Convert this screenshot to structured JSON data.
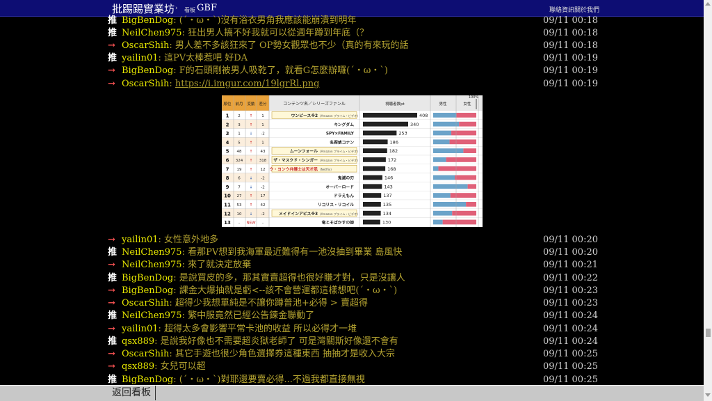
{
  "header": {
    "board_title": "批踢踢實業坊",
    "sep": "›",
    "crumb_label": "看板",
    "board_name": "GBF",
    "links": [
      "聯絡資訊",
      "關於我們"
    ]
  },
  "pushes": [
    {
      "tag": "推",
      "user": "BigBenDog",
      "content": ": (´・ω・`)沒有浴衣男角我應該能崩潰到明年",
      "time": "09/11 00:18"
    },
    {
      "tag": "推",
      "user": "NeilChen975",
      "content": ": 狂出男人搞不好我就可以從週年蹲到年底（？",
      "time": "09/11 00:18"
    },
    {
      "tag": "→",
      "user": "OscarShih",
      "content": ": 男人差不多該狂來了 OP勢女觀眾也不少（真的有來玩的話",
      "time": "09/11 00:18"
    },
    {
      "tag": "推",
      "user": "yailin01",
      "content": ": 這PV太棒惹吧 好DA",
      "time": "09/11 00:19"
    },
    {
      "tag": "→",
      "user": "BigBenDog",
      "content": ": F的石頭剛被男人吸乾了，就看G怎麼辦囉(´・ω・`)",
      "time": "09/11 00:19"
    },
    {
      "tag": "→",
      "user": "OscarShih",
      "content": ": ",
      "link": "https://i.imgur.com/19lgrRl.png",
      "time": "09/11 00:19"
    },
    {
      "tag": "→",
      "user": "yailin01",
      "content": ": 女性意外地多",
      "time": "09/11 00:20"
    },
    {
      "tag": "推",
      "user": "NeilChen975",
      "content": ": 看那PV想到我海軍最近難得有一池沒抽到畢業 島風快",
      "time": "09/11 00:20"
    },
    {
      "tag": "→",
      "user": "NeilChen975",
      "content": ": 來了就決定放棄",
      "time": "09/11 00:21"
    },
    {
      "tag": "推",
      "user": "BigBenDog",
      "content": ": 是說買皮的多，那其實賣超得也很好賺才對，只是沒讓人",
      "time": "09/11 00:22"
    },
    {
      "tag": "→",
      "user": "BigBenDog",
      "content": ": 課金大爆抽就是虧<--該不會營運都這樣想吧(´・ω・`)",
      "time": "09/11 00:23"
    },
    {
      "tag": "→",
      "user": "OscarShih",
      "content": ": 超得少我想單純是不讓你蹲普池+必得 > 賣超得",
      "time": "09/11 00:23"
    },
    {
      "tag": "推",
      "user": "NeilChen975",
      "content": ": 繁中服竟然已經公告鍊金聯動了",
      "time": "09/11 00:24"
    },
    {
      "tag": "→",
      "user": "yailin01",
      "content": ": 超得太多會影響平常卡池的收益 所以必得才一堆",
      "time": "09/11 00:24"
    },
    {
      "tag": "推",
      "user": "qsx889",
      "content": ": 是說我好像也不需要超炎獄老師了 可是灣關斯好像還不會有",
      "time": "09/11 00:24"
    },
    {
      "tag": "→",
      "user": "OscarShih",
      "content": ": 其它手遊也很少角色選擇券這種東西 抽抽才是收入大宗",
      "time": "09/11 00:25"
    },
    {
      "tag": "→",
      "user": "qsx889",
      "content": ": 女兒可以超",
      "time": "09/11 00:25"
    },
    {
      "tag": "推",
      "user": "BigBenDog",
      "content": ": (´・ω・`)對耶還要賣必得...不過我都直接無視",
      "time": "09/11 00:25"
    }
  ],
  "embed": {
    "headers": [
      "順位",
      "前月",
      "変動",
      "差分",
      "コンテンツ名／シリーズファンル",
      "視聴者数pt",
      "男性",
      "女性"
    ],
    "top_mark": "100%",
    "rows": [
      {
        "rank": "1",
        "prev": "2",
        "chg": "↑",
        "diff": "1",
        "title": "ワンピース※2",
        "sub": "(Amazon プライム・ビデオ)",
        "pt": "408",
        "male": 0.54
      },
      {
        "rank": "2",
        "prev": "3",
        "chg": "↑",
        "diff": "1",
        "title": "キングダム",
        "sub": "",
        "pt": "340",
        "male": 0.6
      },
      {
        "rank": "3",
        "prev": "1",
        "chg": "↓",
        "diff": "-2",
        "title": "SPY×FAMILY",
        "sub": "",
        "pt": "253",
        "male": 0.42
      },
      {
        "rank": "4",
        "prev": "5",
        "chg": "↑",
        "diff": "1",
        "title": "名探偵コナン",
        "sub": "",
        "pt": "186",
        "male": 0.38
      },
      {
        "rank": "5",
        "prev": "48",
        "chg": "↑",
        "diff": "43",
        "title": "ムーンフォール",
        "sub": "(Amazon プライム・ビデオ)",
        "pt": "182",
        "male": 0.7
      },
      {
        "rank": "6",
        "prev": "324",
        "chg": "↑",
        "diff": "318",
        "title": "ザ・マスクド・シンガー",
        "sub": "(Amazon プライム・ビデオ)",
        "pt": "172",
        "male": 0.3
      },
      {
        "rank": "7",
        "prev": "19",
        "chg": "↑",
        "diff": "12",
        "title": "ウ・ヨンウ弁護士は天才肌",
        "sub": "(Netflix)",
        "pt": "168",
        "male": 0.12
      },
      {
        "rank": "8",
        "prev": "6",
        "chg": "↓",
        "diff": "-2",
        "title": "鬼滅の刃",
        "sub": "",
        "pt": "146",
        "male": 0.5
      },
      {
        "rank": "9",
        "prev": "7",
        "chg": "↓",
        "diff": "-2",
        "title": "オーバーロード",
        "sub": "",
        "pt": "143",
        "male": 0.8
      },
      {
        "rank": "10",
        "prev": "27",
        "chg": "↑",
        "diff": "17",
        "title": "ドラえもん",
        "sub": "",
        "pt": "137",
        "male": 0.4
      },
      {
        "rank": "11",
        "prev": "53",
        "chg": "↑",
        "diff": "42",
        "title": "リコリス・リコイル",
        "sub": "",
        "pt": "135",
        "male": 0.76
      },
      {
        "rank": "12",
        "prev": "10",
        "chg": "↓",
        "diff": "-2",
        "title": "メイドインアビス※3",
        "sub": "(Amazon プライム・ビデオ)",
        "pt": "134",
        "male": 0.44
      },
      {
        "rank": "13",
        "prev": "-",
        "chg": "NEW",
        "diff": "-",
        "title": "竜とそばかすの姫",
        "sub": "",
        "pt": "130",
        "male": 0.22
      }
    ]
  },
  "footer": {
    "back_label": "返回看板"
  },
  "colors": {
    "topbar": "#0d0d73",
    "user": "#e6e600",
    "content": "#b3a230",
    "arrow": "#ff5555",
    "chart_blue": "#6ba3c9",
    "chart_pink": "#e06078"
  }
}
